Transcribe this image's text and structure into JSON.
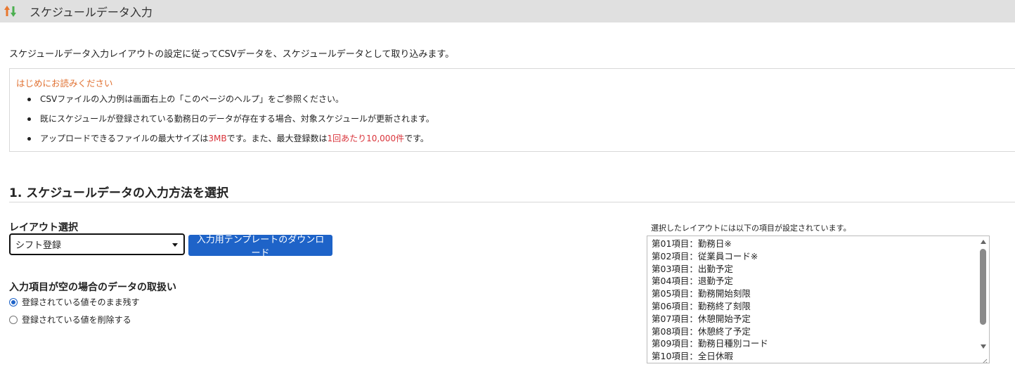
{
  "header": {
    "title": "スケジュールデータ入力",
    "icon": "up-down-arrows-icon",
    "background": "#e0e0e0"
  },
  "description": "スケジュールデータ入力レイアウトの設定に従ってCSVデータを、スケジュールデータとして取り込みます。",
  "notice": {
    "title": "はじめにお読みください",
    "title_color": "#e07030",
    "items": [
      {
        "text": "CSVファイルの入力例は画面右上の「このページのヘルプ」をご参照ください。"
      },
      {
        "text": "既にスケジュールが登録されている勤務日のデータが存在する場合、対象スケジュールが更新されます。"
      },
      {
        "text_before": "アップロードできるファイルの最大サイズは",
        "highlight1": "3MB",
        "text_middle": "です。また、最大登録数は",
        "highlight2": "1回あたり10,000件",
        "text_after": "です。"
      }
    ],
    "highlight_color": "#d9333a"
  },
  "section1": {
    "title": "1. スケジュールデータの入力方法を選択",
    "layout_label": "レイアウト選択",
    "layout_selected": "シフト登録",
    "download_button": "入力用テンプレートのダウンロード",
    "empty_handling_label": "入力項目が空の場合のデータの取扱い",
    "radio_options": [
      {
        "label": "登録されている値そのまま残す",
        "checked": true
      },
      {
        "label": "登録されている値を削除する",
        "checked": false
      }
    ],
    "layout_info_label": "選択したレイアウトには以下の項目が設定されています。",
    "layout_fields": [
      "第01項目：勤務日※",
      "第02項目：従業員コード※",
      "第03項目：出勤予定",
      "第04項目：退勤予定",
      "第05項目：勤務開始刻限",
      "第06項目：勤務終了刻限",
      "第07項目：休憩開始予定",
      "第08項目：休憩終了予定",
      "第09項目：勤務日種別コード",
      "第10項目：全日休暇"
    ]
  },
  "colors": {
    "accent": "#1e63c8",
    "border": "#d8d8d8"
  }
}
